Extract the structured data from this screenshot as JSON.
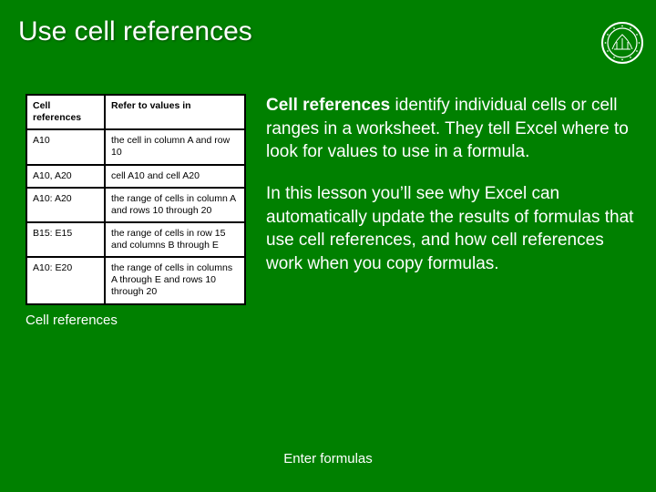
{
  "title": "Use cell references",
  "table": {
    "head": {
      "c1": "Cell references",
      "c2": "Refer to values in"
    },
    "rows": [
      {
        "c1": "A10",
        "c2": "the cell in column A and row 10"
      },
      {
        "c1": "A10, A20",
        "c2": "cell A10 and cell A20"
      },
      {
        "c1": "A10: A20",
        "c2": "the range of cells in column A and rows 10 through 20"
      },
      {
        "c1": "B15: E15",
        "c2": "the range of cells in row 15 and columns B through E"
      },
      {
        "c1": "A10: E20",
        "c2": "the range of cells in columns A through E and rows 10 through 20"
      }
    ]
  },
  "para1_lead": "Cell references",
  "para1_rest": " identify individual cells or cell ranges in a worksheet. They tell Excel where to look for values to use in a formula.",
  "para2": "In this lesson you’ll see why Excel can automatically update the results of formulas that use cell references, and how cell references work when you copy formulas.",
  "subcaption": "Cell references",
  "footer": "Enter formulas"
}
